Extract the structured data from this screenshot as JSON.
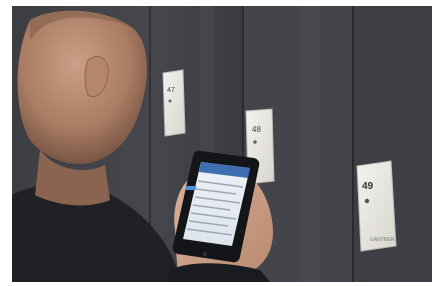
{
  "lockers": [
    {
      "number": "47"
    },
    {
      "number": "48"
    },
    {
      "number": "49",
      "brand": "GANTNER"
    }
  ],
  "phone_screen": {
    "header_lines": 2,
    "list_rows": 7
  }
}
